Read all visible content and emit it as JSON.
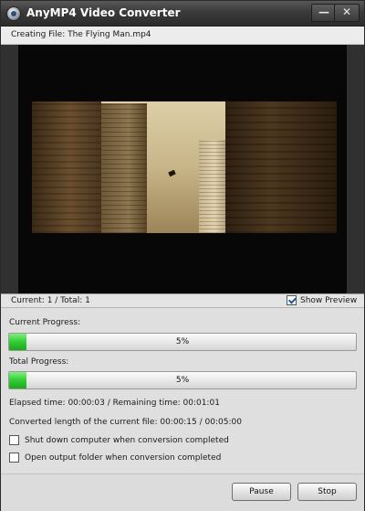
{
  "window": {
    "title": "AnyMP4 Video Converter",
    "minimize_glyph": "—",
    "close_glyph": "✕",
    "app_icon": "app-logo-icon"
  },
  "creating_file": "Creating File: The Flying Man.mp4",
  "preview": {
    "counter": "Current: 1 / Total: 1",
    "show_preview_label": "Show Preview",
    "show_preview_checked": true
  },
  "progress": {
    "current_label": "Current Progress:",
    "current_percent_text": "5%",
    "current_value": 0.05,
    "total_label": "Total Progress:",
    "total_percent_text": "5%",
    "total_value": 0.05,
    "fill_color": "#33cc33"
  },
  "info": {
    "elapsed": "Elapsed time: 00:00:03 / Remaining time: 00:01:01",
    "converted": "Converted length of the current file: 00:00:15 / 00:05:00"
  },
  "options": {
    "shutdown_label": "Shut down computer when conversion completed",
    "shutdown_checked": false,
    "open_folder_label": "Open output folder when conversion completed",
    "open_folder_checked": false
  },
  "buttons": {
    "pause": "Pause",
    "stop": "Stop"
  }
}
